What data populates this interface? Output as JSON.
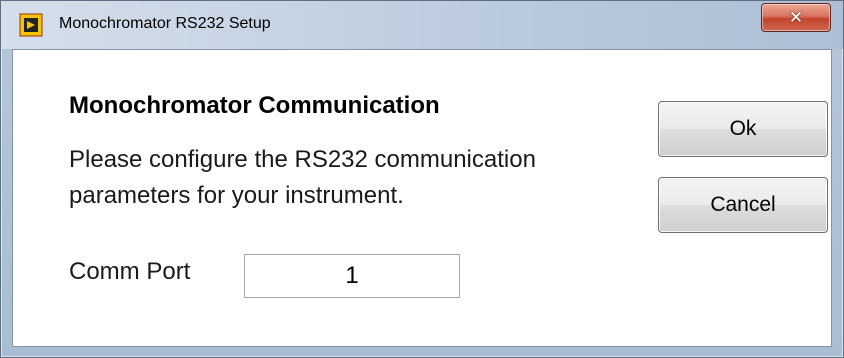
{
  "window": {
    "title": "Monochromator RS232 Setup",
    "close_glyph": "✕"
  },
  "dialog": {
    "heading": "Monochromator Communication",
    "description_lines": [
      "Please configure the RS232 communication",
      "parameters for your instrument."
    ],
    "comm_port_label": "Comm Port",
    "comm_port_value": "1",
    "ok_label": "Ok",
    "cancel_label": "Cancel"
  },
  "icons": {
    "app": "labview-vi-icon",
    "close": "close-icon"
  },
  "colors": {
    "titlebar": "#c5d3e3",
    "close_button": "#c4432c",
    "content_bg": "#ffffff"
  }
}
